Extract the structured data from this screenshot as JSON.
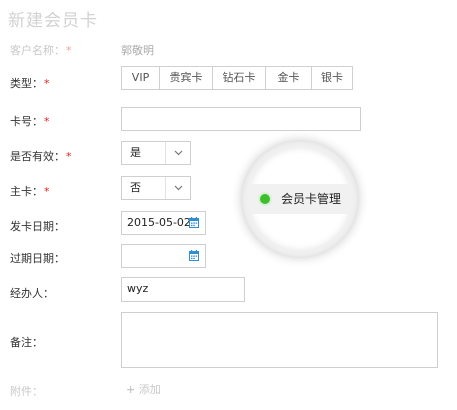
{
  "page_title": "新建会员卡",
  "fields": {
    "customer_name": {
      "label": "客户名称：",
      "required": "*",
      "value": "郭敬明"
    },
    "type": {
      "label": "类型：",
      "required": "*",
      "options": [
        "VIP",
        "贵宾卡",
        "钻石卡",
        "金卡",
        "银卡"
      ]
    },
    "card_no": {
      "label": "卡号：",
      "required": "*",
      "value": ""
    },
    "valid": {
      "label": "是否有效：",
      "required": "*",
      "value": "是"
    },
    "main_card": {
      "label": "主卡：",
      "required": "*",
      "value": "否"
    },
    "issue_date": {
      "label": "发卡日期：",
      "value": "2015-05-02"
    },
    "expire_date": {
      "label": "过期日期：",
      "value": ""
    },
    "handler": {
      "label": "经办人：",
      "value": "wyz"
    },
    "remark": {
      "label": "备注：",
      "value": ""
    },
    "attachment": {
      "label": "附件：",
      "add_label": "添加"
    }
  },
  "overlay": {
    "menu_label": "会员卡管理"
  },
  "icons": {
    "calendar": "calendar-icon",
    "dropdown": "chevron-down-icon",
    "add": "plus-icon",
    "status": "green-dot-icon"
  },
  "colors": {
    "required": "#e02020",
    "status_dot": "#3cbe2e",
    "calendar": "#2c8fd6"
  }
}
